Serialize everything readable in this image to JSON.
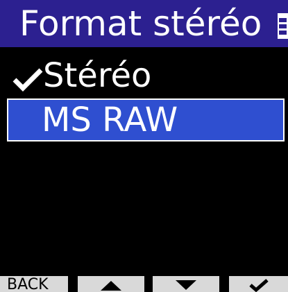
{
  "header": {
    "title": "Format stéréo",
    "battery_icon": "battery-icon"
  },
  "menu": {
    "items": [
      {
        "label": "Stéréo",
        "checked": true,
        "selected": false,
        "icon": "check-icon"
      },
      {
        "label": "MS RAW",
        "checked": false,
        "selected": true
      }
    ]
  },
  "footer": {
    "back_label": "BACK",
    "up_icon": "up-arrow-icon",
    "down_icon": "down-arrow-icon",
    "confirm_icon": "check-icon"
  },
  "colors": {
    "title_bar": "#2c2090",
    "selection": "#2f4fd0",
    "background": "#000000",
    "footer_buttons": "#d9d9d9"
  }
}
